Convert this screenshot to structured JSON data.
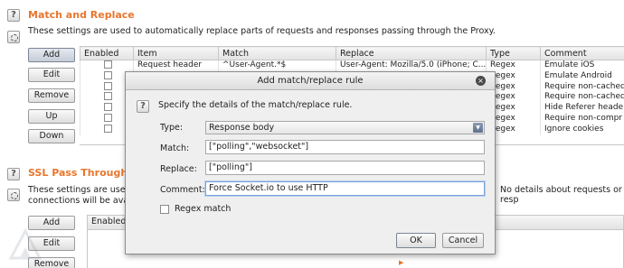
{
  "match_replace": {
    "title": "Match and Replace",
    "description": "These settings are used to automatically replace parts of requests and responses passing through the Proxy.",
    "buttons": {
      "add": "Add",
      "edit": "Edit",
      "remove": "Remove",
      "up": "Up",
      "down": "Down"
    },
    "columns": {
      "enabled": "Enabled",
      "item": "Item",
      "match": "Match",
      "replace": "Replace",
      "type": "Type",
      "comment": "Comment"
    },
    "rows": [
      {
        "item": "Request header",
        "match": "^User-Agent.*$",
        "replace": "User-Agent: Mozilla/5.0 (iPhone; C...",
        "type": "Regex",
        "comment": "Emulate iOS"
      },
      {
        "item": "",
        "match": "",
        "replace": "",
        "type": "Regex",
        "comment": "Emulate Android"
      },
      {
        "item": "",
        "match": "",
        "replace": "",
        "type": "Regex",
        "comment": "Require non-cached"
      },
      {
        "item": "",
        "match": "",
        "replace": "",
        "type": "Regex",
        "comment": "Require non-cached"
      },
      {
        "item": "",
        "match": "",
        "replace": "",
        "type": "Regex",
        "comment": "Hide Referer heade"
      },
      {
        "item": "",
        "match": "",
        "replace": "",
        "type": "Regex",
        "comment": "Require non-compr"
      },
      {
        "item": "",
        "match": "",
        "replace": "",
        "type": "Regex",
        "comment": "Ignore cookies"
      }
    ]
  },
  "ssl": {
    "title": "SSL Pass Through",
    "description_line1": "These settings are used t",
    "description_line2": "connections will be availa",
    "description_right": "No details about requests or resp",
    "buttons": {
      "add": "Add",
      "edit": "Edit",
      "remove": "Remove"
    },
    "columns": {
      "enabled": "Enabled"
    }
  },
  "dialog": {
    "title": "Add match/replace rule",
    "close_symbol": "×",
    "instruction": "Specify the details of the match/replace rule.",
    "type_label": "Type:",
    "type_value": "Response body",
    "match_label": "Match:",
    "match_value": "[\"polling\",\"websocket\"]",
    "replace_label": "Replace:",
    "replace_value": "[\"polling\"]",
    "comment_label": "Comment:",
    "comment_value": "Force Socket.io to use HTTP",
    "regex_label": "Regex match",
    "regex_checked": false,
    "ok_label": "OK",
    "cancel_label": "Cancel"
  },
  "icons": {
    "help": "?",
    "dropdown": "▼",
    "ssl_arrow": "▶"
  },
  "colors": {
    "section_title": "#e8762d",
    "focus": "#7aa3d8"
  }
}
